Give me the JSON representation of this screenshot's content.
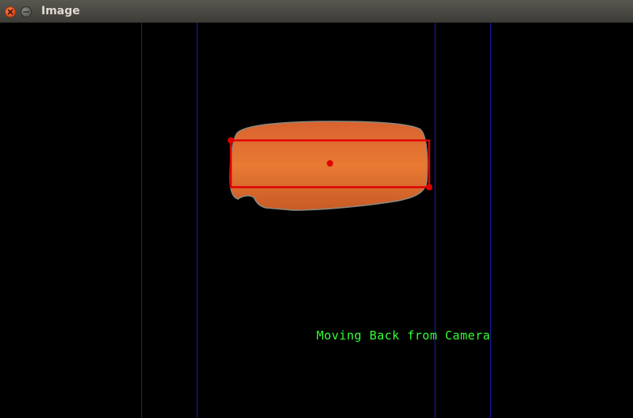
{
  "window": {
    "title": "Image",
    "controls": [
      {
        "name": "close-icon",
        "color": "#e95420"
      },
      {
        "name": "minimize-icon",
        "color": "#6e6e6a"
      }
    ]
  },
  "canvas": {
    "background": "#000000",
    "guide_line_color": "#1c1caa",
    "guide_line_count": 4,
    "detected_object": {
      "description": "orange object",
      "fill_color": "#e0692b",
      "box_color": "#e00000",
      "markers": [
        "top-left-corner",
        "center",
        "bottom-right-corner"
      ]
    },
    "status_text": "Moving Back from Camera",
    "status_color": "#33ff33"
  }
}
